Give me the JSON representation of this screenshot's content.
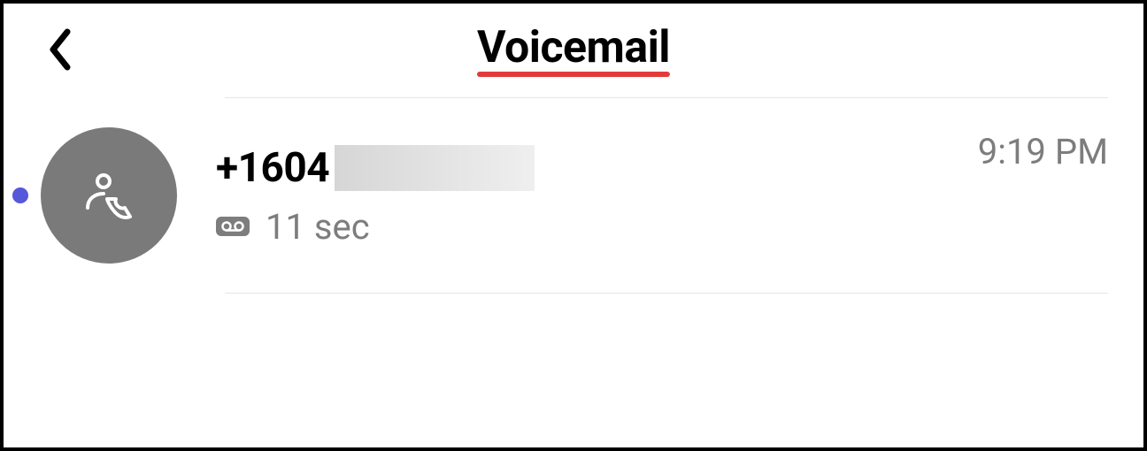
{
  "header": {
    "title": "Voicemail",
    "underline_color": "#e23a3a"
  },
  "voicemails": [
    {
      "unread": true,
      "phone_prefix": "+1604",
      "phone_redacted": true,
      "duration": "11 sec",
      "time": "9:19 PM"
    }
  ]
}
